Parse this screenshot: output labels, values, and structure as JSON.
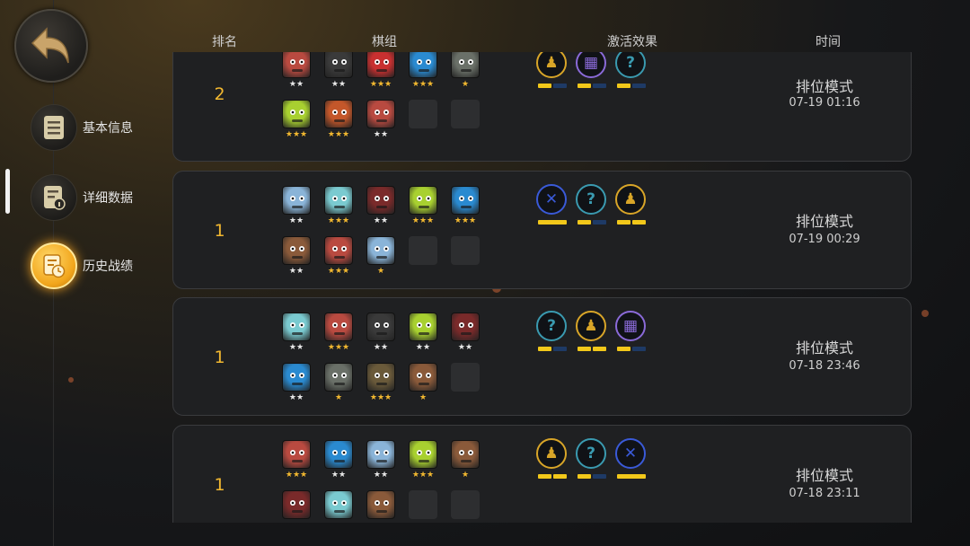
{
  "nav": {
    "back_icon": "back-arrow-icon",
    "items": [
      {
        "label": "基本信息",
        "icon": "document-icon",
        "active": false
      },
      {
        "label": "详细数据",
        "icon": "info-document-icon",
        "active": false
      },
      {
        "label": "历史战绩",
        "icon": "history-clock-icon",
        "active": true
      }
    ]
  },
  "table": {
    "headers": {
      "rank": "排名",
      "lineup": "棋组",
      "synergy": "激活效果",
      "time": "时间"
    },
    "rows": [
      {
        "rank": "2",
        "mode": "排位模式",
        "time": "07-19 01:16",
        "pieces": [
          {
            "color": "#b94a40",
            "stars": "★★"
          },
          {
            "color": "#3a3a3a",
            "stars": "★★"
          },
          {
            "color": "#c83030",
            "stars": "★★★"
          },
          {
            "color": "#2a8ad0",
            "stars": "★★★"
          },
          {
            "color": "#6a7068",
            "stars": "★"
          },
          {
            "color": "#a8d030",
            "stars": "★★★"
          },
          {
            "color": "#c4572a",
            "stars": "★★★"
          },
          {
            "color": "#b94a40",
            "stars": "★★"
          },
          {
            "color": "",
            "stars": ""
          },
          {
            "color": "",
            "stars": ""
          }
        ],
        "synergies": [
          {
            "icon": "hood-icon",
            "ring": "#d8a528",
            "glyph": "♟",
            "segs": [
              1,
              0
            ]
          },
          {
            "icon": "mech-icon",
            "ring": "#8a6ad8",
            "glyph": "▦",
            "segs": [
              1,
              0
            ]
          },
          {
            "icon": "question-icon",
            "ring": "#3a9ab0",
            "glyph": "?",
            "segs": [
              1,
              0
            ]
          }
        ]
      },
      {
        "rank": "1",
        "mode": "排位模式",
        "time": "07-19 00:29",
        "pieces": [
          {
            "color": "#8ab4d8",
            "stars": "★★"
          },
          {
            "color": "#7acad0",
            "stars": "★★★"
          },
          {
            "color": "#7a2a2a",
            "stars": "★★"
          },
          {
            "color": "#a8d030",
            "stars": "★★★"
          },
          {
            "color": "#2a8ad0",
            "stars": "★★★"
          },
          {
            "color": "#8a5a3a",
            "stars": "★★"
          },
          {
            "color": "#b94a40",
            "stars": "★★★"
          },
          {
            "color": "#8ab4d8",
            "stars": "★"
          },
          {
            "color": "",
            "stars": ""
          },
          {
            "color": "",
            "stars": ""
          }
        ],
        "synergies": [
          {
            "icon": "blade-icon",
            "ring": "#3a5ad8",
            "glyph": "✕",
            "segs": [
              3
            ]
          },
          {
            "icon": "question-icon",
            "ring": "#3a9ab0",
            "glyph": "?",
            "segs": [
              1,
              0
            ]
          },
          {
            "icon": "hood-icon",
            "ring": "#d8a528",
            "glyph": "♟",
            "segs": [
              1,
              1
            ]
          }
        ]
      },
      {
        "rank": "1",
        "mode": "排位模式",
        "time": "07-18 23:46",
        "pieces": [
          {
            "color": "#7acad0",
            "stars": "★★"
          },
          {
            "color": "#b94a40",
            "stars": "★★★"
          },
          {
            "color": "#3a3a3a",
            "stars": "★★"
          },
          {
            "color": "#a8d030",
            "stars": "★★"
          },
          {
            "color": "#7a2a2a",
            "stars": "★★"
          },
          {
            "color": "#2a8ad0",
            "stars": "★★"
          },
          {
            "color": "#6a7068",
            "stars": "★"
          },
          {
            "color": "#6a5a3a",
            "stars": "★★★"
          },
          {
            "color": "#8a5a3a",
            "stars": "★"
          },
          {
            "color": "",
            "stars": ""
          }
        ],
        "synergies": [
          {
            "icon": "question-icon",
            "ring": "#3a9ab0",
            "glyph": "?",
            "segs": [
              1,
              0
            ]
          },
          {
            "icon": "hood-icon",
            "ring": "#d8a528",
            "glyph": "♟",
            "segs": [
              1,
              1
            ]
          },
          {
            "icon": "mech-icon",
            "ring": "#8a6ad8",
            "glyph": "▦",
            "segs": [
              1,
              0
            ]
          }
        ]
      },
      {
        "rank": "1",
        "mode": "排位模式",
        "time": "07-18 23:11",
        "pieces": [
          {
            "color": "#b94a40",
            "stars": "★★★"
          },
          {
            "color": "#2a8ad0",
            "stars": "★★"
          },
          {
            "color": "#8ab4d8",
            "stars": "★★"
          },
          {
            "color": "#a8d030",
            "stars": "★★★"
          },
          {
            "color": "#8a5a3a",
            "stars": "★"
          },
          {
            "color": "#7a2a2a",
            "stars": ""
          },
          {
            "color": "#7acad0",
            "stars": ""
          },
          {
            "color": "#8a5a3a",
            "stars": ""
          },
          {
            "color": "",
            "stars": ""
          },
          {
            "color": "",
            "stars": ""
          }
        ],
        "synergies": [
          {
            "icon": "hood-icon",
            "ring": "#d8a528",
            "glyph": "♟",
            "segs": [
              1,
              1
            ]
          },
          {
            "icon": "question-icon",
            "ring": "#3a9ab0",
            "glyph": "?",
            "segs": [
              1,
              0
            ]
          },
          {
            "icon": "blade-icon",
            "ring": "#3a5ad8",
            "glyph": "✕",
            "segs": [
              3
            ]
          }
        ]
      }
    ]
  },
  "colors": {
    "accent_gold": "#f2b830",
    "bar_on": "#f2c81a",
    "bar_off": "#1e3a66",
    "star_silver": "#e8e8e8",
    "star_gold": "#f2b830"
  }
}
